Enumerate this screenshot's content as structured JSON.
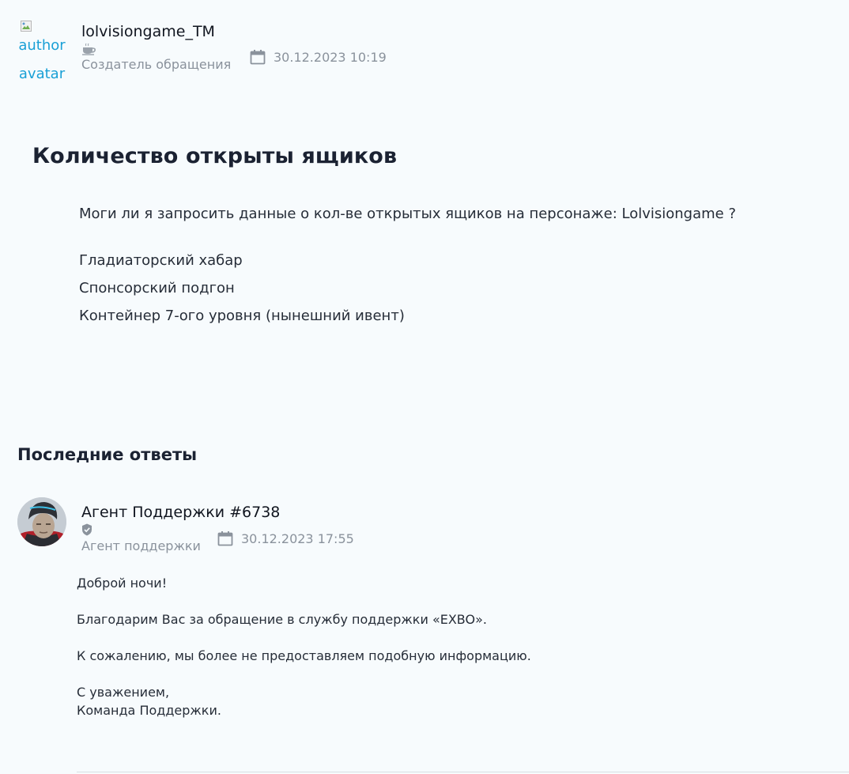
{
  "ticket": {
    "author": {
      "avatar_alt": "author avatar",
      "name": "lolvisiongame_TM",
      "rank_icon": "coffee-cup-icon",
      "role": "Создатель обращения",
      "date": "30.12.2023 10:19"
    },
    "title": "Количество открыты ящиков",
    "question": "Моги ли я запросить данные о кол-ве открытых ящиков на персонаже: Lolvisiongame ?",
    "items": [
      "Гладиаторский хабар",
      "Спонсорский подгон",
      "Контейнер 7-ого уровня (нынешний ивент)"
    ]
  },
  "replies": {
    "heading": "Последние ответы",
    "agent": {
      "name": "Агент Поддержки #6738",
      "badge_icon": "shield-check-icon",
      "role": "Агент поддержки",
      "date": "30.12.2023 17:55"
    },
    "message": {
      "greeting": "Доброй ночи!",
      "thanks": "Благодарим Вас за обращение в службу поддержки «EXBO».",
      "body": "К сожалению, мы более не предоставляем подобную информацию.",
      "signoff_1": "С уважением,",
      "signoff_2": "Команда Поддержки."
    }
  },
  "colors": {
    "background": "#f7fbfd",
    "muted_text": "#8a929c",
    "link_alt": "#1aa0d6"
  }
}
